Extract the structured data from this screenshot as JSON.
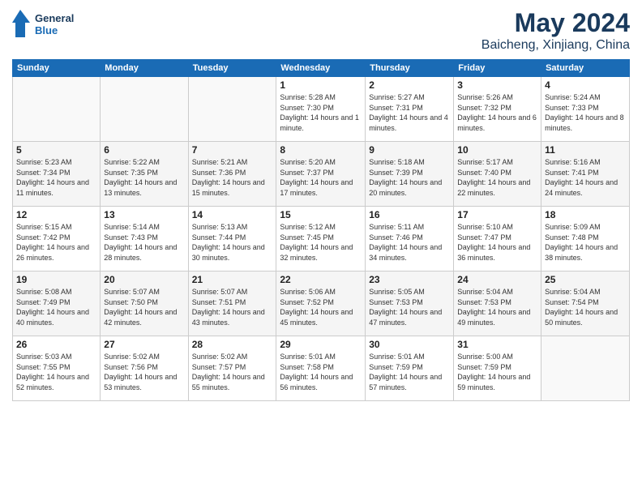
{
  "header": {
    "logo_text_general": "General",
    "logo_text_blue": "Blue",
    "month": "May 2024",
    "location": "Baicheng, Xinjiang, China"
  },
  "weekdays": [
    "Sunday",
    "Monday",
    "Tuesday",
    "Wednesday",
    "Thursday",
    "Friday",
    "Saturday"
  ],
  "weeks": [
    [
      {
        "day": "",
        "sunrise": "",
        "sunset": "",
        "daylight": ""
      },
      {
        "day": "",
        "sunrise": "",
        "sunset": "",
        "daylight": ""
      },
      {
        "day": "",
        "sunrise": "",
        "sunset": "",
        "daylight": ""
      },
      {
        "day": "1",
        "sunrise": "Sunrise: 5:28 AM",
        "sunset": "Sunset: 7:30 PM",
        "daylight": "Daylight: 14 hours and 1 minute."
      },
      {
        "day": "2",
        "sunrise": "Sunrise: 5:27 AM",
        "sunset": "Sunset: 7:31 PM",
        "daylight": "Daylight: 14 hours and 4 minutes."
      },
      {
        "day": "3",
        "sunrise": "Sunrise: 5:26 AM",
        "sunset": "Sunset: 7:32 PM",
        "daylight": "Daylight: 14 hours and 6 minutes."
      },
      {
        "day": "4",
        "sunrise": "Sunrise: 5:24 AM",
        "sunset": "Sunset: 7:33 PM",
        "daylight": "Daylight: 14 hours and 8 minutes."
      }
    ],
    [
      {
        "day": "5",
        "sunrise": "Sunrise: 5:23 AM",
        "sunset": "Sunset: 7:34 PM",
        "daylight": "Daylight: 14 hours and 11 minutes."
      },
      {
        "day": "6",
        "sunrise": "Sunrise: 5:22 AM",
        "sunset": "Sunset: 7:35 PM",
        "daylight": "Daylight: 14 hours and 13 minutes."
      },
      {
        "day": "7",
        "sunrise": "Sunrise: 5:21 AM",
        "sunset": "Sunset: 7:36 PM",
        "daylight": "Daylight: 14 hours and 15 minutes."
      },
      {
        "day": "8",
        "sunrise": "Sunrise: 5:20 AM",
        "sunset": "Sunset: 7:37 PM",
        "daylight": "Daylight: 14 hours and 17 minutes."
      },
      {
        "day": "9",
        "sunrise": "Sunrise: 5:18 AM",
        "sunset": "Sunset: 7:39 PM",
        "daylight": "Daylight: 14 hours and 20 minutes."
      },
      {
        "day": "10",
        "sunrise": "Sunrise: 5:17 AM",
        "sunset": "Sunset: 7:40 PM",
        "daylight": "Daylight: 14 hours and 22 minutes."
      },
      {
        "day": "11",
        "sunrise": "Sunrise: 5:16 AM",
        "sunset": "Sunset: 7:41 PM",
        "daylight": "Daylight: 14 hours and 24 minutes."
      }
    ],
    [
      {
        "day": "12",
        "sunrise": "Sunrise: 5:15 AM",
        "sunset": "Sunset: 7:42 PM",
        "daylight": "Daylight: 14 hours and 26 minutes."
      },
      {
        "day": "13",
        "sunrise": "Sunrise: 5:14 AM",
        "sunset": "Sunset: 7:43 PM",
        "daylight": "Daylight: 14 hours and 28 minutes."
      },
      {
        "day": "14",
        "sunrise": "Sunrise: 5:13 AM",
        "sunset": "Sunset: 7:44 PM",
        "daylight": "Daylight: 14 hours and 30 minutes."
      },
      {
        "day": "15",
        "sunrise": "Sunrise: 5:12 AM",
        "sunset": "Sunset: 7:45 PM",
        "daylight": "Daylight: 14 hours and 32 minutes."
      },
      {
        "day": "16",
        "sunrise": "Sunrise: 5:11 AM",
        "sunset": "Sunset: 7:46 PM",
        "daylight": "Daylight: 14 hours and 34 minutes."
      },
      {
        "day": "17",
        "sunrise": "Sunrise: 5:10 AM",
        "sunset": "Sunset: 7:47 PM",
        "daylight": "Daylight: 14 hours and 36 minutes."
      },
      {
        "day": "18",
        "sunrise": "Sunrise: 5:09 AM",
        "sunset": "Sunset: 7:48 PM",
        "daylight": "Daylight: 14 hours and 38 minutes."
      }
    ],
    [
      {
        "day": "19",
        "sunrise": "Sunrise: 5:08 AM",
        "sunset": "Sunset: 7:49 PM",
        "daylight": "Daylight: 14 hours and 40 minutes."
      },
      {
        "day": "20",
        "sunrise": "Sunrise: 5:07 AM",
        "sunset": "Sunset: 7:50 PM",
        "daylight": "Daylight: 14 hours and 42 minutes."
      },
      {
        "day": "21",
        "sunrise": "Sunrise: 5:07 AM",
        "sunset": "Sunset: 7:51 PM",
        "daylight": "Daylight: 14 hours and 43 minutes."
      },
      {
        "day": "22",
        "sunrise": "Sunrise: 5:06 AM",
        "sunset": "Sunset: 7:52 PM",
        "daylight": "Daylight: 14 hours and 45 minutes."
      },
      {
        "day": "23",
        "sunrise": "Sunrise: 5:05 AM",
        "sunset": "Sunset: 7:53 PM",
        "daylight": "Daylight: 14 hours and 47 minutes."
      },
      {
        "day": "24",
        "sunrise": "Sunrise: 5:04 AM",
        "sunset": "Sunset: 7:53 PM",
        "daylight": "Daylight: 14 hours and 49 minutes."
      },
      {
        "day": "25",
        "sunrise": "Sunrise: 5:04 AM",
        "sunset": "Sunset: 7:54 PM",
        "daylight": "Daylight: 14 hours and 50 minutes."
      }
    ],
    [
      {
        "day": "26",
        "sunrise": "Sunrise: 5:03 AM",
        "sunset": "Sunset: 7:55 PM",
        "daylight": "Daylight: 14 hours and 52 minutes."
      },
      {
        "day": "27",
        "sunrise": "Sunrise: 5:02 AM",
        "sunset": "Sunset: 7:56 PM",
        "daylight": "Daylight: 14 hours and 53 minutes."
      },
      {
        "day": "28",
        "sunrise": "Sunrise: 5:02 AM",
        "sunset": "Sunset: 7:57 PM",
        "daylight": "Daylight: 14 hours and 55 minutes."
      },
      {
        "day": "29",
        "sunrise": "Sunrise: 5:01 AM",
        "sunset": "Sunset: 7:58 PM",
        "daylight": "Daylight: 14 hours and 56 minutes."
      },
      {
        "day": "30",
        "sunrise": "Sunrise: 5:01 AM",
        "sunset": "Sunset: 7:59 PM",
        "daylight": "Daylight: 14 hours and 57 minutes."
      },
      {
        "day": "31",
        "sunrise": "Sunrise: 5:00 AM",
        "sunset": "Sunset: 7:59 PM",
        "daylight": "Daylight: 14 hours and 59 minutes."
      },
      {
        "day": "",
        "sunrise": "",
        "sunset": "",
        "daylight": ""
      }
    ]
  ]
}
